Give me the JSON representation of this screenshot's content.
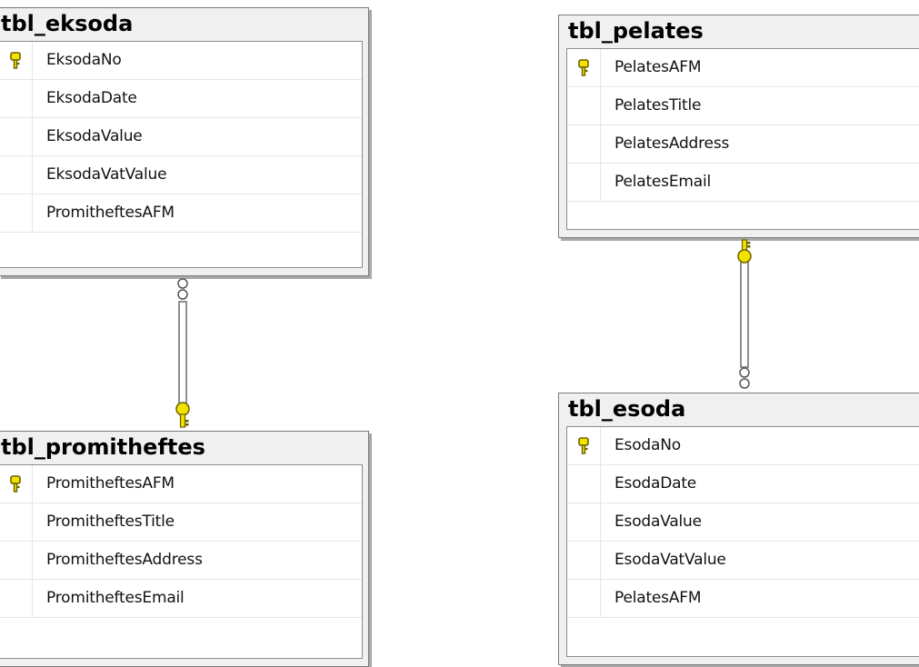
{
  "tables": {
    "eksoda": {
      "name": "tbl_eksoda",
      "columns": [
        "EksodaNo",
        "EksodaDate",
        "EksodaValue",
        "EksodaVatValue",
        "PromitheftesAFM"
      ],
      "primary_key": "EksodaNo"
    },
    "pelates": {
      "name": "tbl_pelates",
      "columns": [
        "PelatesAFM",
        "PelatesTitle",
        "PelatesAddress",
        "PelatesEmail"
      ],
      "primary_key": "PelatesAFM"
    },
    "promitheftes": {
      "name": "tbl_promitheftes",
      "columns": [
        "PromitheftesAFM",
        "PromitheftesTitle",
        "PromitheftesAddress",
        "PromitheftesEmail"
      ],
      "primary_key": "PromitheftesAFM"
    },
    "esoda": {
      "name": "tbl_esoda",
      "columns": [
        "EsodaNo",
        "EsodaDate",
        "EsodaValue",
        "EsodaVatValue",
        "PelatesAFM"
      ],
      "primary_key": "EsodaNo"
    }
  },
  "relationships": [
    {
      "from": "tbl_eksoda",
      "to": "tbl_promitheftes",
      "many_end": "tbl_eksoda",
      "one_end": "tbl_promitheftes"
    },
    {
      "from": "tbl_esoda",
      "to": "tbl_pelates",
      "many_end": "tbl_esoda",
      "one_end": "tbl_pelates"
    }
  ],
  "colors": {
    "key": "#f2e200",
    "key_outline": "#6b6200",
    "line": "#6a6a6a"
  }
}
